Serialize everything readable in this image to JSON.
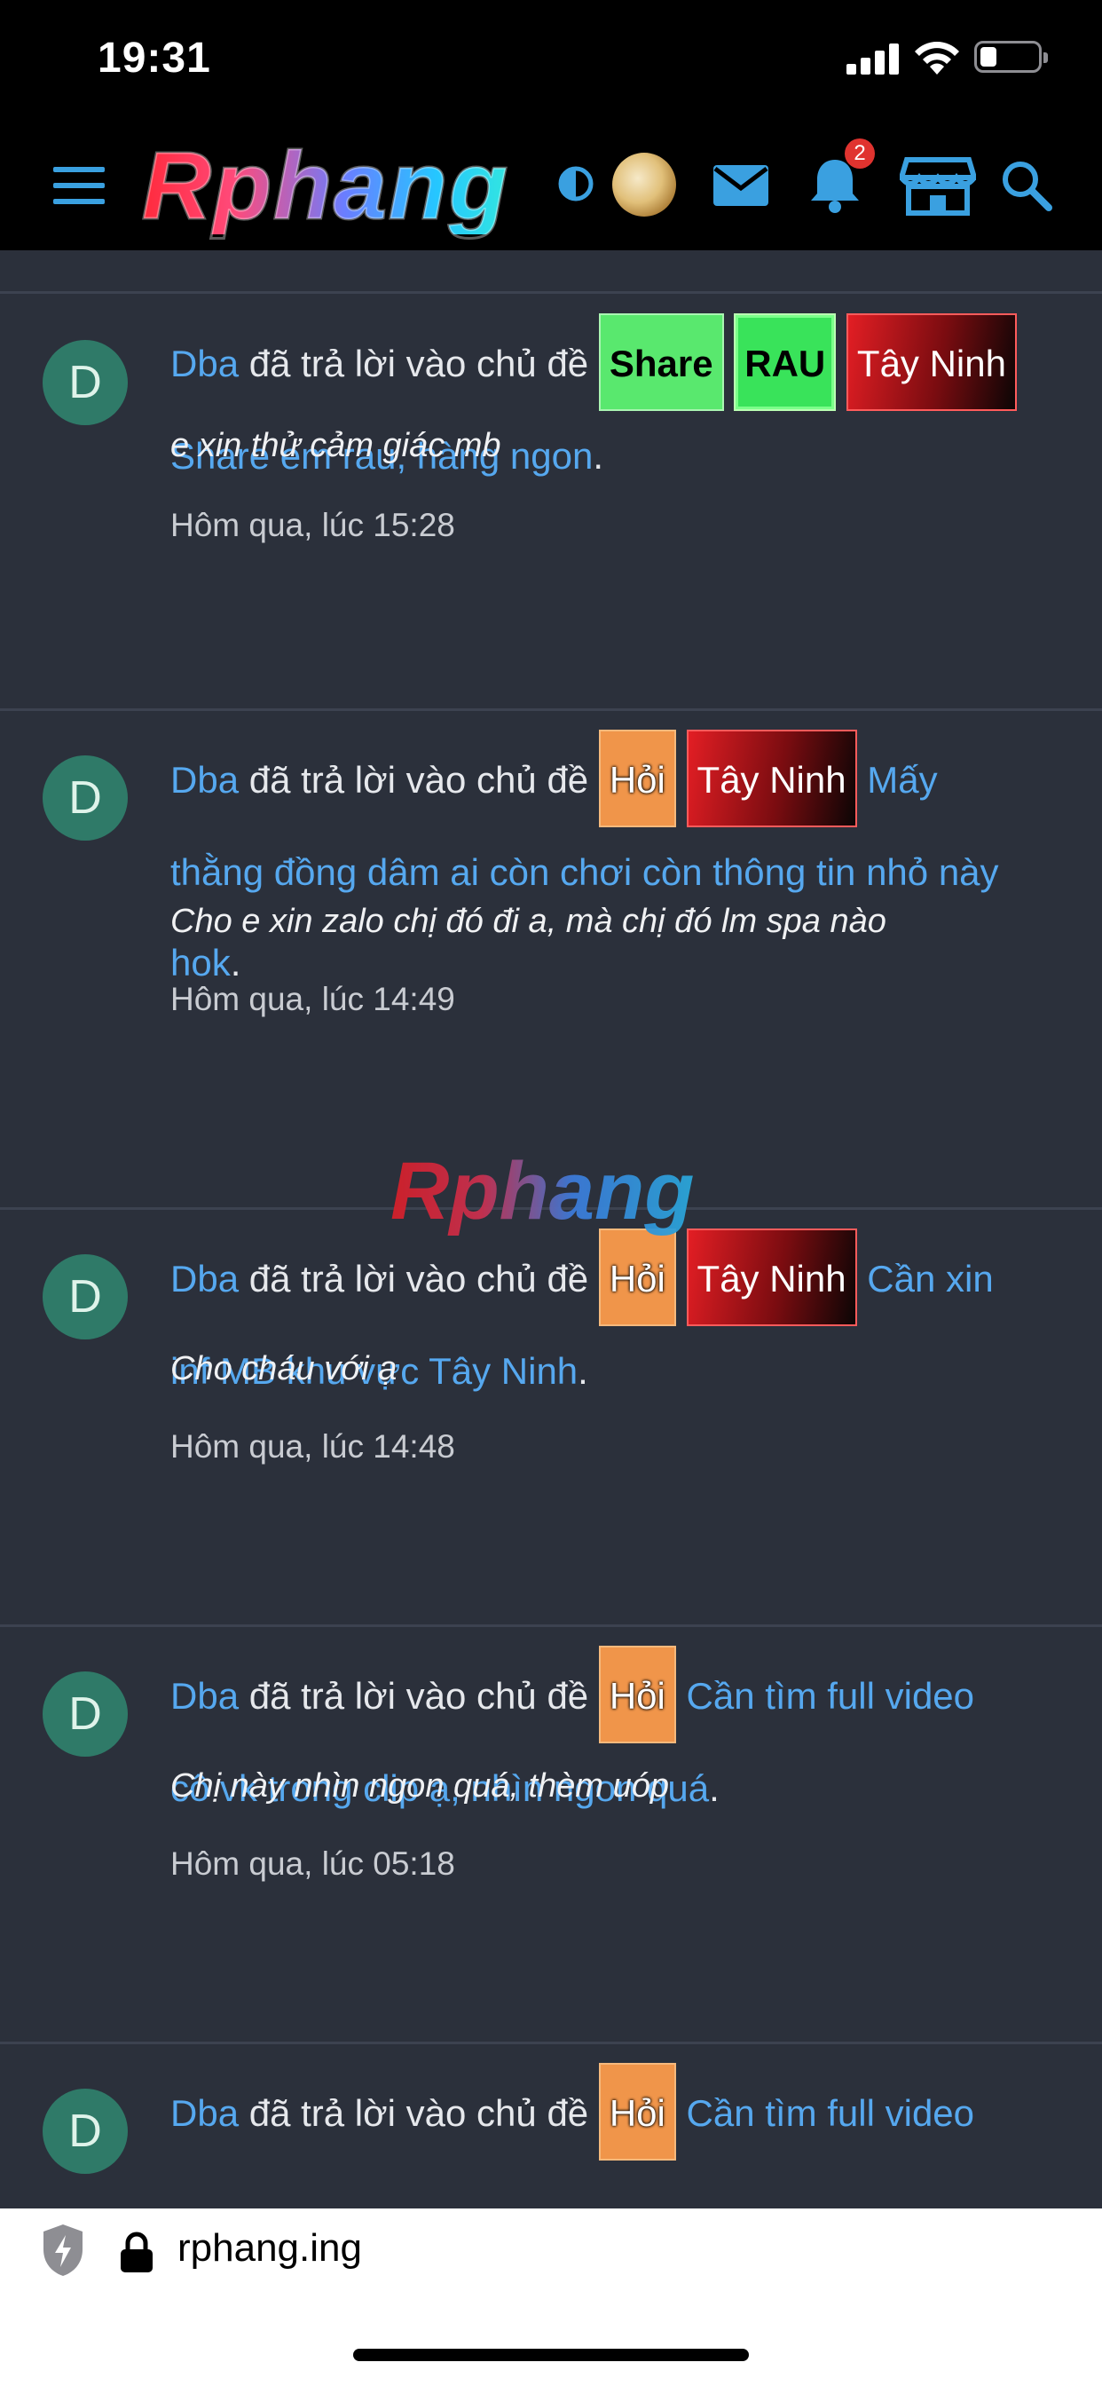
{
  "status_bar": {
    "time": "19:31"
  },
  "nav": {
    "logo_text": "Rphang",
    "notification_count": "2"
  },
  "watermark": "Rphang",
  "feed": [
    {
      "avatar_letter": "D",
      "user": "Dba",
      "action": "đã trả lời vào chủ đề",
      "tags": [
        "Share",
        "RAU",
        "Tây Ninh"
      ],
      "thread_title": "Share em rau, hàng ngon",
      "snippet": "e xin thử cảm giác mb",
      "time": "Hôm qua, lúc 15:28"
    },
    {
      "avatar_letter": "D",
      "user": "Dba",
      "action": "đã trả lời vào chủ đề",
      "tags": [
        "Hỏi",
        "Tây Ninh"
      ],
      "thread_title_a": "Mấy",
      "thread_title_b": "thằng đồng dâm ai còn chơi còn thông tin nhỏ này",
      "thread_title_c": "hok",
      "snippet": "Cho e xin zalo chị đó đi a, mà chị đó lm spa nào",
      "time": "Hôm qua, lúc 14:49"
    },
    {
      "avatar_letter": "D",
      "user": "Dba",
      "action": "đã trả lời vào chủ đề",
      "tags": [
        "Hỏi",
        "Tây Ninh"
      ],
      "thread_title_a": "Cần xin",
      "thread_title_b": "inf MB khu vực Tây Ninh",
      "snippet": "Cho cháu với ạ",
      "time": "Hôm qua, lúc 14:48"
    },
    {
      "avatar_letter": "D",
      "user": "Dba",
      "action": "đã trả lời vào chủ đề",
      "tags": [
        "Hỏi"
      ],
      "thread_title_a": "Cần tìm full video",
      "thread_title_b": "cô vk trong clip ạ, nhìn ngon quá",
      "snippet": "Chị này nhìn ngon quá, thèm uóp",
      "time": "Hôm qua, lúc 05:18"
    },
    {
      "avatar_letter": "D",
      "user": "Dba",
      "action": "đã trả lời vào chủ đề",
      "tags": [
        "Hỏi"
      ],
      "thread_title_a": "Cần tìm full video"
    }
  ],
  "punct": {
    "period": "."
  },
  "browser": {
    "url": "rphang.ing"
  },
  "colors": {
    "background": "#2b303b",
    "link": "#56a8ef",
    "avatar": "#2f7a68",
    "accent": "#3aa0e0"
  }
}
